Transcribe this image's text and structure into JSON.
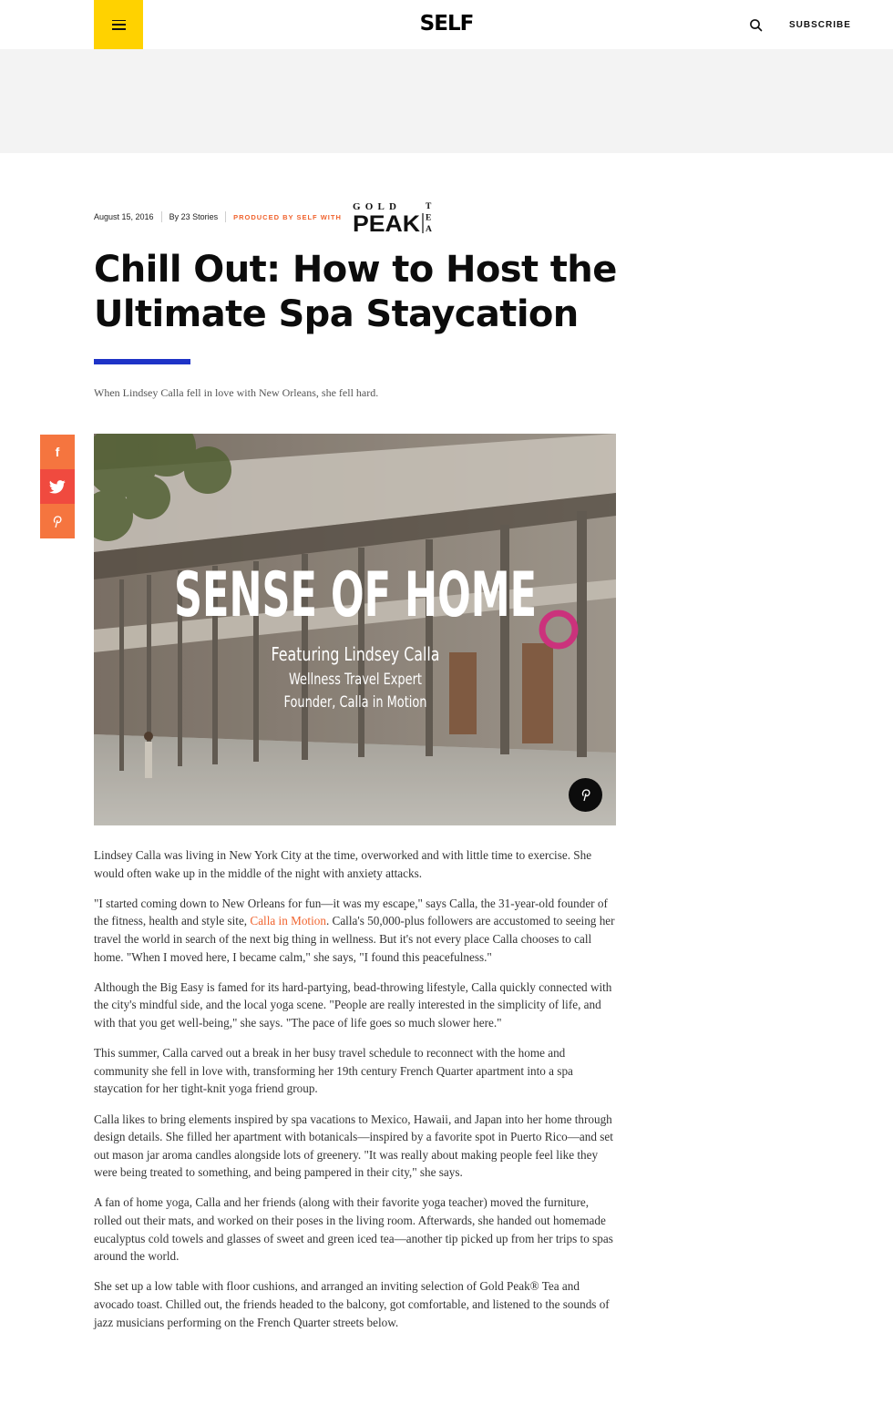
{
  "header": {
    "logo": "SELF",
    "subscribe_label": "SUBSCRIBE"
  },
  "meta": {
    "date": "August 15, 2016",
    "byline": "By 23 Stories",
    "produced": "PRODUCED BY SELF WITH",
    "sponsor_logo": {
      "top": "GOLD",
      "main": "PEAK",
      "side": "TEA"
    }
  },
  "article": {
    "title": "Chill Out: How to Host the Ultimate Spa Staycation",
    "dek": "When Lindsey Calla fell in love with New Orleans, she fell hard.",
    "hero": {
      "headline": "SENSE OF HOME",
      "line1": "Featuring Lindsey Calla",
      "line2": "Wellness Travel Expert",
      "line3": "Founder, Calla in Motion"
    },
    "paragraphs": {
      "p1": "Lindsey Calla was living in New York City at the time, overworked and with little time to exercise. She would often wake up in the middle of the night with anxiety attacks.",
      "p2_before": "\"I started coming down to New Orleans for fun—it was my escape,\" says Calla, the 31-year-old founder of the fitness, health and style site, ",
      "p2_link": "Calla in Motion",
      "p2_after": ". Calla's 50,000-plus followers are accustomed to seeing her travel the world in search of the next big thing in wellness. But it's not every place Calla chooses to call home. \"When I moved here, I became calm,\" she says, \"I found this peacefulness.\"",
      "p3": "Although the Big Easy is famed for its hard-partying, bead-throwing lifestyle, Calla quickly connected with the city's mindful side, and the local yoga scene. \"People are really interested in the simplicity of life, and with that you get well-being,\" she says. \"The pace of life goes so much slower here.\"",
      "p4": "This summer, Calla carved out a break in her busy travel schedule to reconnect with the home and community she fell in love with, transforming her 19th century French Quarter apartment into a spa staycation for her tight-knit yoga friend group.",
      "p5": "Calla likes to bring elements inspired by spa vacations to Mexico, Hawaii, and Japan into her home through design details. She filled her apartment with botanicals—inspired by a favorite spot in Puerto Rico—and set out mason jar aroma candles alongside lots of greenery. \"It was really about making people feel like they were being treated to something, and being pampered in their city,\" she says.",
      "p6": "A fan of home yoga, Calla and her friends (along with their favorite yoga teacher) moved the furniture, rolled out their mats, and worked on their poses in the living room. Afterwards, she handed out homemade eucalyptus cold towels and glasses of sweet and green iced tea—another tip picked up from her trips to spas around the world.",
      "p7": "She set up a low table with floor cushions, and arranged an inviting selection of Gold Peak® Tea and avocado toast. Chilled out, the friends headed to the balcony, got comfortable, and listened to the sounds of jazz musicians performing on the French Quarter streets below."
    }
  },
  "share": {
    "facebook_icon": "facebook-icon",
    "twitter_icon": "twitter-icon",
    "pinterest_icon": "pinterest-icon"
  },
  "colors": {
    "menu_yellow": "#ffd200",
    "accent_orange": "#f0632e",
    "rule_blue": "#1e33c7",
    "share_orange": "#f5753f",
    "share_red": "#f04a3f"
  }
}
